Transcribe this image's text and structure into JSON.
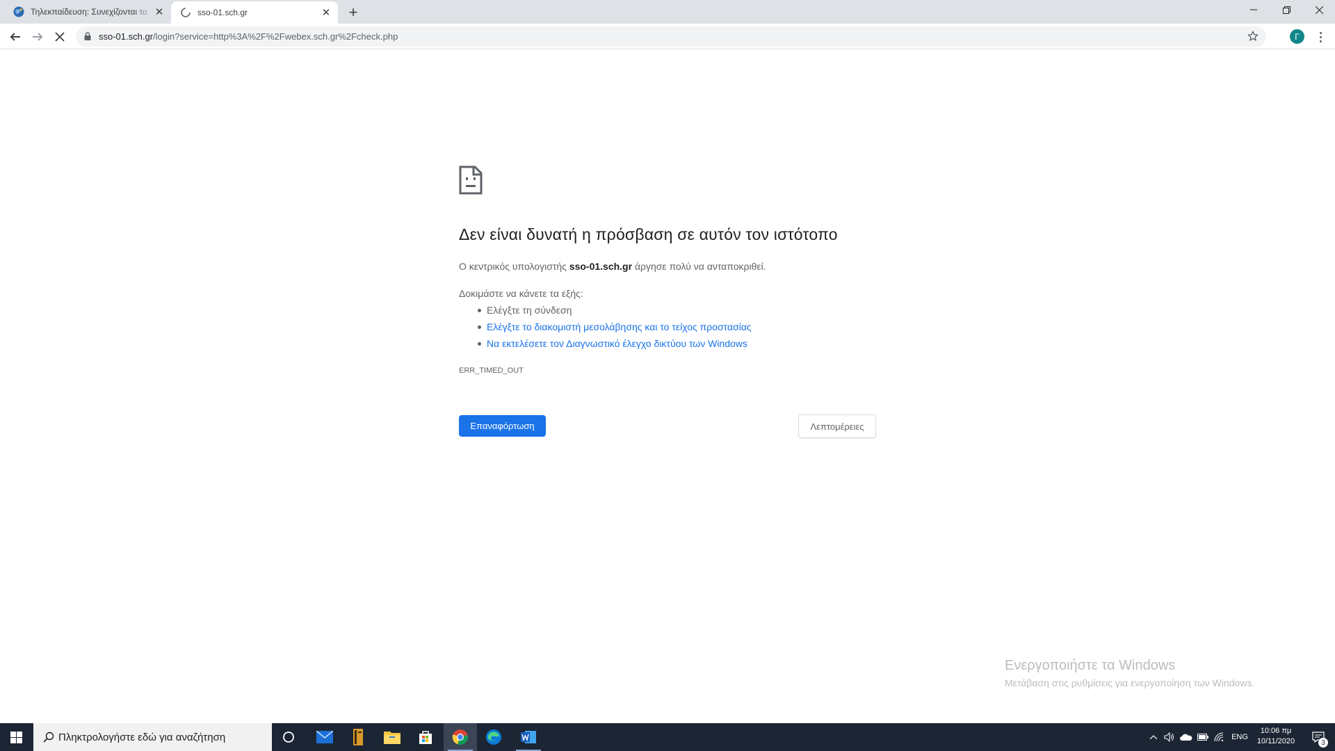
{
  "browser": {
    "tabs": [
      {
        "title": "Τηλεκπαίδευση: Συνεχίζονται τα",
        "active": false,
        "favicon": "site-globe-icon"
      },
      {
        "title": "sso-01.sch.gr",
        "active": true,
        "favicon": "loading-spinner-icon"
      }
    ],
    "new_tab": "+",
    "address": {
      "host": "sso-01.sch.gr",
      "path": "/login?service=http%3A%2F%2Fwebex.sch.gr%2Fcheck.php"
    },
    "profile_initial": "Γ"
  },
  "error_page": {
    "heading": "Δεν είναι δυνατή η πρόσβαση σε αυτόν τον ιστότοπο",
    "summary_prefix": "Ο κεντρικός υπολογιστής ",
    "summary_host": "sso-01.sch.gr",
    "summary_suffix": " άργησε πολύ να ανταποκριθεί.",
    "suggestions_title": "Δοκιμάστε να κάνετε τα εξής:",
    "suggestions": [
      {
        "text": "Ελέγξτε τη σύνδεση",
        "is_link": false
      },
      {
        "text": "Ελέγξτε το διακομιστή μεσολάβησης και το τείχος προστασίας",
        "is_link": true
      },
      {
        "text": "Να εκτελέσετε τον Διαγνωστικό έλεγχο δικτύου των Windows",
        "is_link": true
      }
    ],
    "error_code": "ERR_TIMED_OUT",
    "reload_button": "Επαναφόρτωση",
    "details_button": "Λεπτομέρειες"
  },
  "watermark": {
    "line1": "Ενεργοποιήστε τα Windows",
    "line2": "Μετάβαση στις ρυθμίσεις για ενεργοποίηση των Windows."
  },
  "taskbar": {
    "search_placeholder": "Πληκτρολογήστε εδώ για αναζήτηση",
    "language": "ENG",
    "time": "10:06 πμ",
    "date": "10/11/2020",
    "notification_count": "3"
  },
  "colors": {
    "accent": "#1a73e8",
    "taskbar": "#1c2533",
    "tabstrip": "#dee1e6"
  }
}
